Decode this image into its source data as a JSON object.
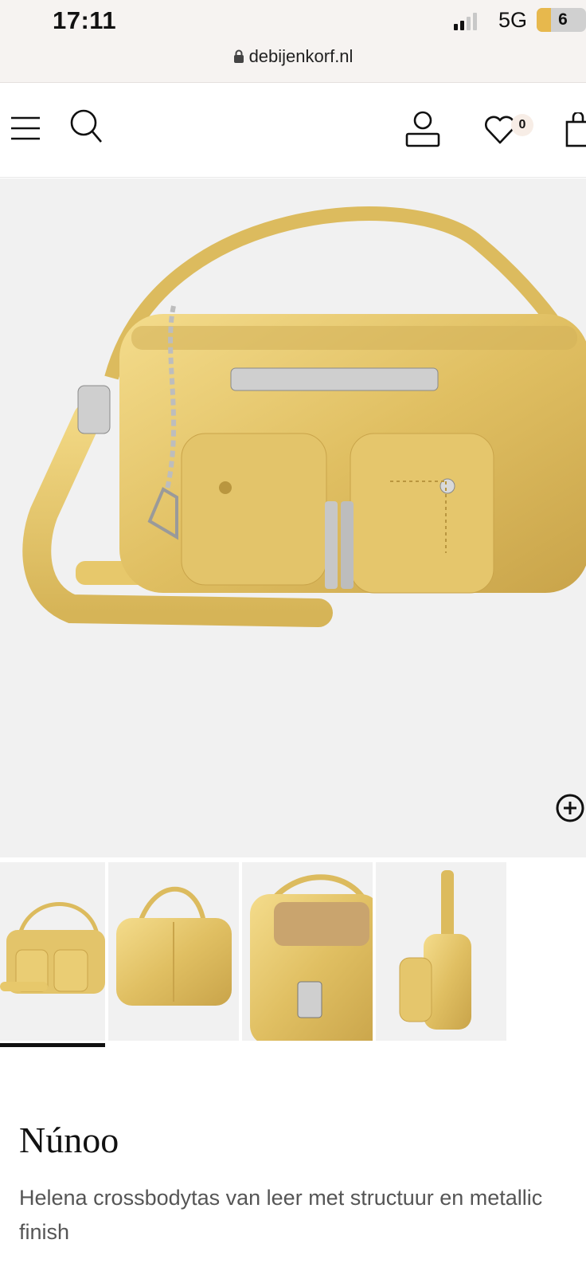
{
  "status_bar": {
    "time": "17:11",
    "network": "5G",
    "battery": "6"
  },
  "browser": {
    "url": "debijenkorf.nl"
  },
  "header": {
    "icons": [
      "menu-icon",
      "search-icon",
      "account-icon",
      "wishlist-icon",
      "bag-icon"
    ],
    "wishlist_count": "0"
  },
  "product": {
    "brand": "Núnoo",
    "description": "Helena crossbodytas van leer met structuur en metallic finish"
  },
  "gallery": {
    "selected_index": 0,
    "thumbnail_count": 4
  },
  "colors": {
    "accent_badge": "#f7ede6",
    "product_gold": "#e3c46a",
    "background": "#f1f1f1"
  }
}
